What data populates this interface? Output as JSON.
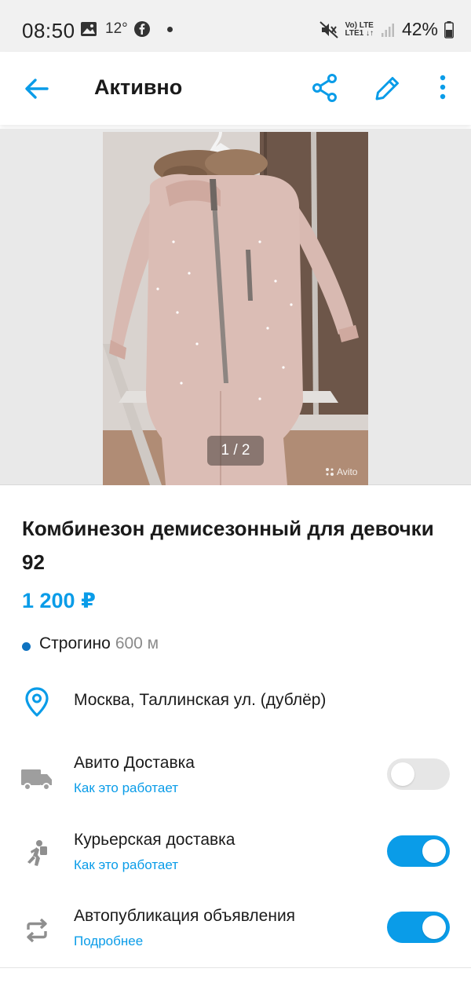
{
  "status_bar": {
    "time": "08:50",
    "temperature": "12°",
    "battery": "42%",
    "network_top": "Vo) LTE",
    "network_bottom": "LTE1 ↓↑",
    "icons": [
      "image-icon",
      "facebook-icon",
      "mute-icon",
      "signal-icon",
      "battery-icon"
    ]
  },
  "toolbar": {
    "title": "Активно",
    "back_icon": "arrow-left-icon",
    "actions": [
      "share-icon",
      "edit-icon",
      "more-vertical-icon"
    ]
  },
  "gallery": {
    "counter": "1 / 2",
    "watermark": "Avito"
  },
  "ad": {
    "title": "Комбинезон демисезонный для девочки 92",
    "price": "1 200 ₽",
    "metro_station": "Строгино",
    "metro_distance": "600 м",
    "address": "Москва, Таллинская ул. (дублёр)"
  },
  "options": [
    {
      "label": "Авито Доставка",
      "link": "Как это работает",
      "enabled": false,
      "icon": "truck-icon"
    },
    {
      "label": "Курьерская доставка",
      "link": "Как это работает",
      "enabled": true,
      "icon": "courier-icon"
    },
    {
      "label": "Автопубликация объявления",
      "link": "Подробнее",
      "enabled": true,
      "icon": "repeat-icon"
    }
  ],
  "colors": {
    "accent": "#0a9ce8",
    "metro_line": "#0f73c0",
    "toggle_off": "#e6e6e6",
    "text": "#1a1a1a",
    "muted": "#8a8a8a"
  }
}
